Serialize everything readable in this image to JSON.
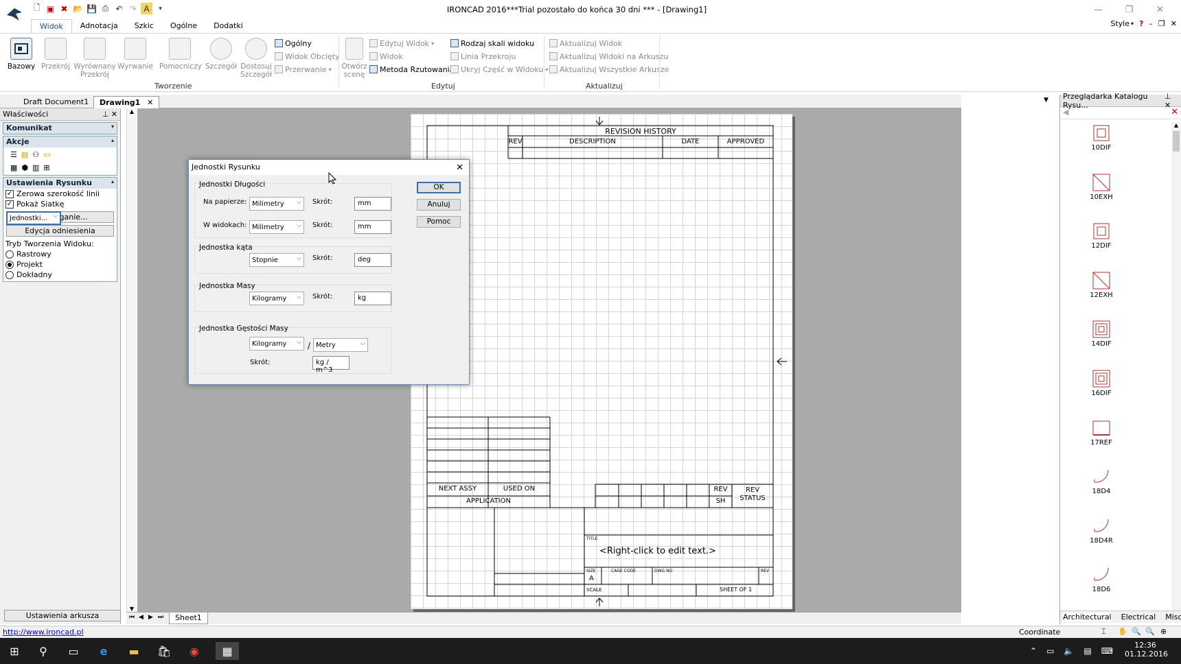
{
  "window": {
    "title": "IRONCAD 2016***Trial pozostało do końca 30 dni *** - [Drawing1]"
  },
  "menu_tabs": [
    "Widok",
    "Adnotacja",
    "Szkic",
    "Ogólne",
    "Dodatki"
  ],
  "ribbon_right": {
    "style_label": "Style"
  },
  "ribbon": {
    "big_buttons": [
      {
        "label": "Bazowy",
        "enabled": true
      },
      {
        "label": "Przekrój",
        "enabled": false
      },
      {
        "label": "Wyrównany Przekrój",
        "enabled": false
      },
      {
        "label": "Wyrwanie",
        "enabled": false
      },
      {
        "label": "Pomocniczy",
        "enabled": false
      },
      {
        "label": "Szczegół",
        "enabled": false
      },
      {
        "label": "Dostosuj Szczegół",
        "enabled": false
      }
    ],
    "small_col1": [
      {
        "label": "Ogólny",
        "enabled": true
      },
      {
        "label": "Widok Obcięty",
        "enabled": false
      },
      {
        "label": "Przerwanie",
        "enabled": false
      }
    ],
    "open_scene": "Otwórz scenę",
    "small_col2": [
      {
        "label": "Edytuj Widok",
        "enabled": false
      },
      {
        "label": "Widok",
        "enabled": false
      },
      {
        "label": "Metoda Rzutowania",
        "enabled": true
      }
    ],
    "small_col3": [
      {
        "label": "Rodzaj skali widoku",
        "enabled": true
      },
      {
        "label": "Linia Przekroju",
        "enabled": false
      },
      {
        "label": "Ukryj Część w Widoku",
        "enabled": false
      }
    ],
    "small_col4": [
      {
        "label": "Aktualizuj Widok",
        "enabled": false
      },
      {
        "label": "Aktualizuj Widoki na Arkuszu",
        "enabled": false
      },
      {
        "label": "Aktualizuj Wszystkie Arkusze",
        "enabled": false
      }
    ],
    "groups": [
      "Tworzenie",
      "Edytuj",
      "Aktualizuj"
    ]
  },
  "doc_tabs": [
    "Draft Document1",
    "Drawing1"
  ],
  "properties": {
    "title": "Właściwości",
    "komunikat": "Komunikat",
    "akcje": "Akcje",
    "settings_title": "Ustawienia Rysunku",
    "check_zero_width": "Zerowa szerokość linii",
    "check_show_grid": "Pokaż Siatkę",
    "btn_units": "Jednostki...",
    "btn_snap": "Przyciąganie...",
    "btn_ref": "Edycja odniesienia",
    "mode_label": "Tryb Tworzenia Widoku:",
    "modes": [
      "Rastrowy",
      "Projekt",
      "Dokładny"
    ],
    "selected_mode": "Projekt",
    "sheet_settings": "Ustawienia arkusza"
  },
  "catalog": {
    "title": "Przeglądarka Katalogu Rysu...",
    "items": [
      "10DIF",
      "10EXH",
      "12DIF",
      "12EXH",
      "14DIF",
      "16DIF",
      "17REF",
      "18D4",
      "18D4R",
      "18D6"
    ],
    "bottom_tabs": [
      "Architectural",
      "Electrical",
      "Misc"
    ]
  },
  "sheet": {
    "revision_history": "REVISION HISTORY",
    "rev_cols": [
      "REV",
      "DESCRIPTION",
      "DATE",
      "APPROVED"
    ],
    "next_assy": "NEXT ASSY",
    "used_on": "USED ON",
    "application": "APPLICATION",
    "rev": "REV",
    "sh": "SH",
    "rev_status": "REV STATUS",
    "title_lbl": "TITLE",
    "title_text": "<Right-click to edit text.>",
    "size_lbl": "SIZE",
    "size_val": "A",
    "cage_code": "CAGE CODE",
    "dwg_no": "DWG NO",
    "rev_lbl": "REV",
    "scale_lbl": "SCALE",
    "sheet_of": "SHEET OF 1"
  },
  "sheet_tab": "Sheet1",
  "status": {
    "url": "http://www.ironcad.pl",
    "coordinate": "Coordinate"
  },
  "clock": {
    "time": "12:36",
    "date": "01.12.2016"
  },
  "dialog": {
    "title": "Jednostki Rysunku",
    "group_length": "Jednostki Długości",
    "on_paper": "Na papierze:",
    "in_views": "W widokach:",
    "unit_mm": "Milimetry",
    "abbr": "Skrót:",
    "mm": "mm",
    "group_angle": "Jednostka kąta",
    "unit_deg": "Stopnie",
    "deg": "deg",
    "group_mass": "Jednostka Masy",
    "unit_kg": "Kilogramy",
    "kg": "kg",
    "group_density": "Jednostka Gęstości Masy",
    "unit_m": "Metry",
    "slash": "/",
    "density_abbr": "kg / m^3",
    "ok": "OK",
    "cancel": "Anuluj",
    "help": "Pomoc"
  }
}
